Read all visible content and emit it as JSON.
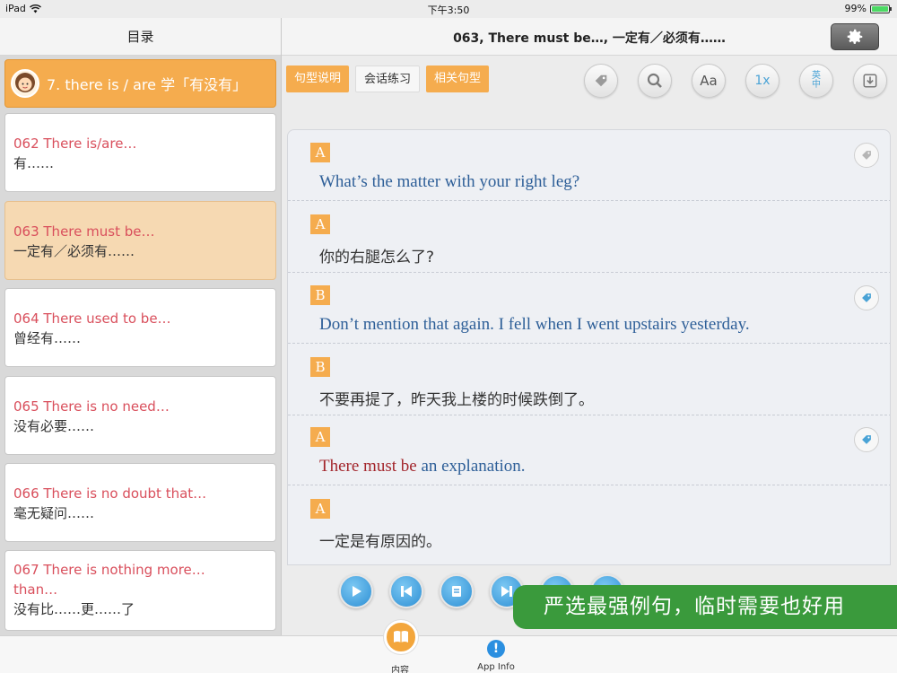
{
  "status": {
    "device": "iPad",
    "time": "下午3:50",
    "battery": "99%",
    "battery_level": 0.99
  },
  "left_header": {
    "title": "目录"
  },
  "right_header": {
    "title": "063, There must be…, 一定有／必须有……"
  },
  "category": {
    "label": "7. there is / are 学「有没有」"
  },
  "lessons": [
    {
      "en": "062 There is/are…",
      "zh": "有……"
    },
    {
      "en": "063 There must be…",
      "zh": "一定有／必须有……"
    },
    {
      "en": "064 There used to be…",
      "zh": "曾经有……"
    },
    {
      "en": "065 There is no need…",
      "zh": "没有必要……"
    },
    {
      "en": "066 There is no doubt that…",
      "zh": "毫无疑问……"
    },
    {
      "en": "067 There is nothing more…",
      "en2": "than…",
      "zh": "没有比……更……了"
    }
  ],
  "tabs": [
    {
      "label": "句型说明"
    },
    {
      "label": "会话练习"
    },
    {
      "label": "相关句型"
    }
  ],
  "tools": {
    "font_label": "Aa",
    "speed_label": "1x",
    "lang_top": "英",
    "lang_bottom": "中"
  },
  "dialogue": [
    {
      "speaker": "A",
      "text": "What’s the matter with your right leg?"
    },
    {
      "speaker": "A",
      "text": "你的右腿怎么了?"
    },
    {
      "speaker": "B",
      "text": "Don’t mention that again. I fell when I went upstairs yesterday."
    },
    {
      "speaker": "B",
      "text": "不要再提了，昨天我上楼的时候跌倒了。"
    },
    {
      "speaker": "A",
      "highlight": "There must be",
      "text_rest": " an explanation."
    },
    {
      "speaker": "A",
      "text": "一定是有原因的。"
    }
  ],
  "promo": {
    "text": "严选最强例句，临时需要也好用"
  },
  "tabbar": {
    "content_label": "内容",
    "info_label": "App Info",
    "info_glyph": "!"
  },
  "colors": {
    "accent": "#f5ac4e",
    "english_text": "#2e5f98",
    "highlight": "#a3262c",
    "lesson_title": "#d94f5c",
    "promo_bg": "#3a9a3c"
  }
}
